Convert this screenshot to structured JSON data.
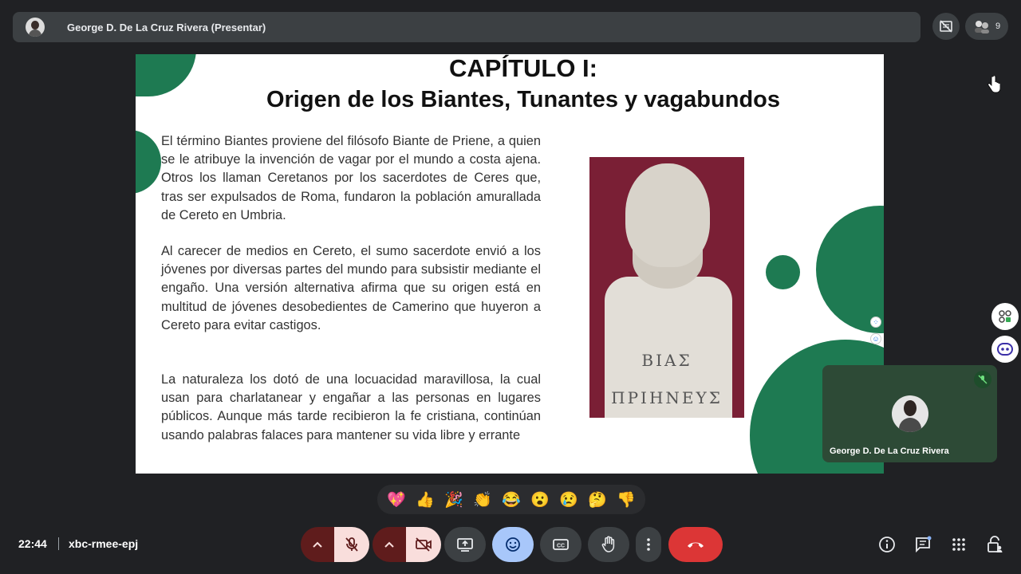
{
  "presenter": {
    "name": "George D. De La Cruz Rivera (Presentar)",
    "participant_count": "9"
  },
  "slide": {
    "title_line1": "CAPÍTULO I:",
    "title_line2": "Origen de los Biantes, Tunantes y vagabundos",
    "paragraphs": [
      "El término Biantes proviene del filósofo Biante de Priene, a quien se le atribuye la invención de vagar por el mundo a costa ajena. Otros los llaman Ceretanos por los sacerdotes de Ceres que, tras ser expulsados de Roma, fundaron la población amurallada de Cereto en Umbria.",
      "Al carecer de medios en Cereto, el sumo sacerdote envió a los jóvenes por diversas partes del mundo para subsistir mediante el engaño. Una versión alternativa afirma que su origen está en multitud de jóvenes desobedientes de Camerino que huyeron a Cereto para evitar castigos.",
      "La naturaleza los dotó de una locuacidad maravillosa, la cual usan para charlatanear y engañar a las personas en lugares públicos. Aunque más tarde recibieron la fe cristiana, continúan usando palabras falaces para mantener su vida libre y errante"
    ],
    "bust_inscription_line1": "ΒΙΑΣ",
    "bust_inscription_line2": "ΠΡΙΗΝΕΥΣ",
    "accent_color": "#1e7a52"
  },
  "self_view": {
    "name": "George D. De La Cruz Rivera"
  },
  "reactions": [
    "💖",
    "👍",
    "🎉",
    "👏",
    "😂",
    "😮",
    "😢",
    "🤔",
    "👎"
  ],
  "bottom_bar": {
    "time": "22:44",
    "meeting_code": "xbc-rmee-epj"
  }
}
